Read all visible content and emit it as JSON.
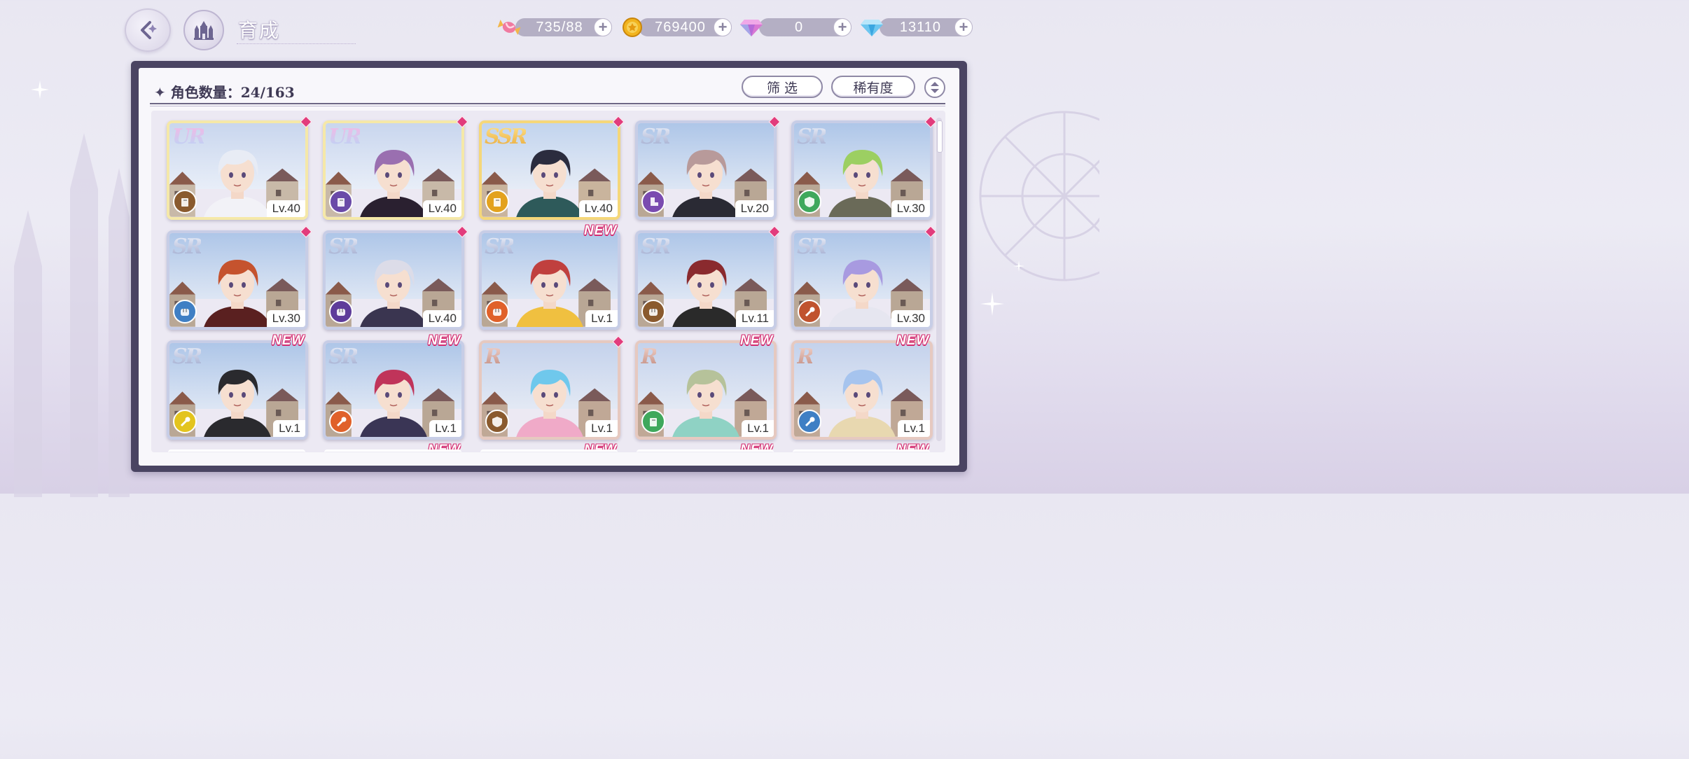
{
  "header": {
    "title": "育成",
    "back_icon": "back-arrow-icon",
    "home_icon": "castle-icon"
  },
  "currencies": [
    {
      "icon": "candy-icon",
      "value": "735/88"
    },
    {
      "icon": "gold-coin-icon",
      "value": "769400"
    },
    {
      "icon": "pink-gem-icon",
      "value": "0"
    },
    {
      "icon": "blue-diamond-icon",
      "value": "13110"
    }
  ],
  "panel": {
    "count_label": "角色数量：24/163",
    "filter_label": "筛 选",
    "rarity_label": "稀有度"
  },
  "cards": [
    {
      "rarity": "UR",
      "level": "Lv.40",
      "attr": "book",
      "new": false,
      "mark": true,
      "palette": "ur"
    },
    {
      "rarity": "UR",
      "level": "Lv.40",
      "attr": "book",
      "new": false,
      "mark": true,
      "palette": "ur"
    },
    {
      "rarity": "SSR",
      "level": "Lv.40",
      "attr": "book",
      "new": false,
      "mark": true,
      "palette": "ssr"
    },
    {
      "rarity": "SR",
      "level": "Lv.20",
      "attr": "boot",
      "new": false,
      "mark": true,
      "palette": "sr"
    },
    {
      "rarity": "SR",
      "level": "Lv.30",
      "attr": "shield",
      "new": false,
      "mark": true,
      "palette": "sr"
    },
    {
      "rarity": "SR",
      "level": "Lv.30",
      "attr": "fist",
      "new": false,
      "mark": true,
      "palette": "sr"
    },
    {
      "rarity": "SR",
      "level": "Lv.40",
      "attr": "fist",
      "new": false,
      "mark": true,
      "palette": "sr"
    },
    {
      "rarity": "SR",
      "level": "Lv.1",
      "attr": "fist",
      "new": true,
      "mark": false,
      "palette": "sr"
    },
    {
      "rarity": "SR",
      "level": "Lv.11",
      "attr": "fist",
      "new": false,
      "mark": true,
      "palette": "sr"
    },
    {
      "rarity": "SR",
      "level": "Lv.30",
      "attr": "wand",
      "new": false,
      "mark": true,
      "palette": "sr"
    },
    {
      "rarity": "SR",
      "level": "Lv.1",
      "attr": "wand",
      "new": true,
      "mark": false,
      "palette": "sr"
    },
    {
      "rarity": "SR",
      "level": "Lv.1",
      "attr": "wand",
      "new": true,
      "mark": false,
      "palette": "sr"
    },
    {
      "rarity": "R",
      "level": "Lv.1",
      "attr": "shield",
      "new": false,
      "mark": true,
      "palette": "r"
    },
    {
      "rarity": "R",
      "level": "Lv.1",
      "attr": "book",
      "new": true,
      "mark": false,
      "palette": "r"
    },
    {
      "rarity": "R",
      "level": "Lv.1",
      "attr": "wand",
      "new": true,
      "mark": false,
      "palette": "r"
    }
  ],
  "new_label": "NEW",
  "attr_colors": [
    "#8a5a2e",
    "#6a4aa8",
    "#e3a21e",
    "#7a4bb0",
    "#3fa85c",
    "#3f7fc4",
    "#5e3c9a",
    "#e0612a",
    "#8a5a2e",
    "#c0532e",
    "#e3c41e",
    "#e0612a",
    "#8a5a2e",
    "#3fa85c",
    "#3f7fc4"
  ]
}
